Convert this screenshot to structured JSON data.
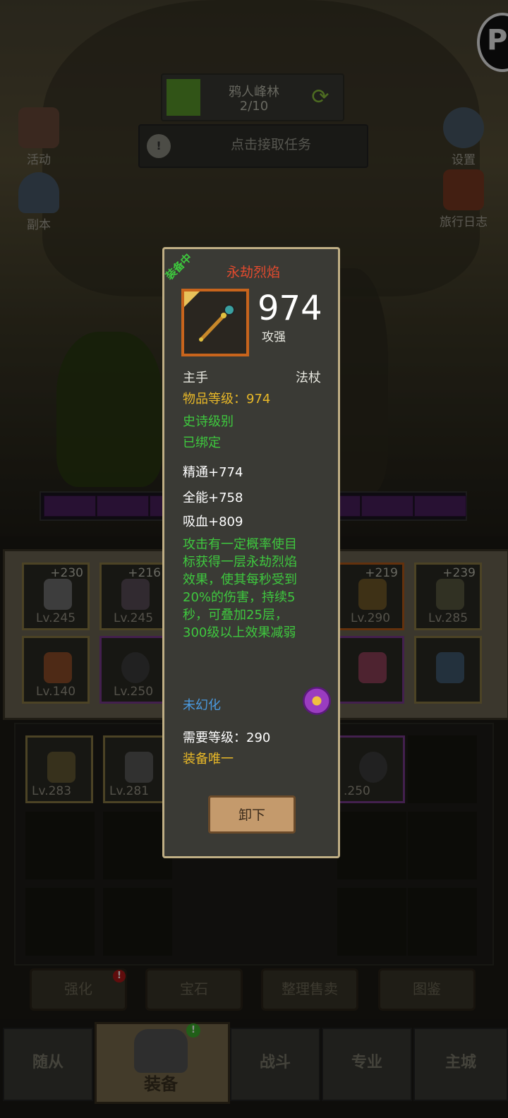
{
  "top": {
    "quest_title": "鸦人峰林",
    "quest_count": "2/10",
    "task_text": "点击接取任务",
    "task_icon": "!",
    "corner_button": "P"
  },
  "side": {
    "activity": "活动",
    "dungeon": "副本",
    "settings": "设置",
    "journal": "旅行日志"
  },
  "equipment_slots": [
    {
      "level": "Lv.245",
      "plus": "+230"
    },
    {
      "level": "Lv.245",
      "plus": "+216"
    },
    {
      "level": "Lv.290",
      "plus": "+219"
    },
    {
      "level": "Lv.285",
      "plus": "+239"
    },
    {
      "level": "Lv.140",
      "plus": ""
    },
    {
      "level": "Lv.250",
      "plus": ""
    }
  ],
  "bag_items": [
    {
      "level": "Lv.283"
    },
    {
      "level": "Lv.281"
    },
    {
      "level": ".250"
    }
  ],
  "actions": {
    "enhance": "强化",
    "gem": "宝石",
    "sort_sell": "整理售卖",
    "codex": "图鉴",
    "enhance_alert": "!"
  },
  "nav": {
    "follower": "随从",
    "equipment": "装备",
    "battle": "战斗",
    "profession": "专业",
    "main_city": "主城",
    "equipment_alert": "!"
  },
  "tooltip": {
    "badge": "装备中",
    "name": "永劫烈焰",
    "value": "974",
    "value_label": "攻强",
    "slot": "主手",
    "type": "法杖",
    "item_level": "物品等级：974",
    "rarity": "史诗级别",
    "bound": "已绑定",
    "stats": [
      "精通+774",
      "全能+758",
      "吸血+809"
    ],
    "description": "攻击有一定概率使目标获得一层永劫烈焰效果，使其每秒受到20%的伤害，持续5秒，可叠加25层，300级以上效果减弱",
    "transmog": "未幻化",
    "required_level": "需要等级：290",
    "unique": "装备唯一",
    "unequip_button": "卸下"
  },
  "colors": {
    "name_red": "#e24a2e",
    "green": "#3ec83e",
    "gold": "#e8b828",
    "blue": "#4a9ae0",
    "tooltip_border": "#bfae84"
  },
  "icons": {
    "refresh": "refresh-icon",
    "weapon": "staff-icon",
    "transmog": "transmog-orb-icon"
  }
}
